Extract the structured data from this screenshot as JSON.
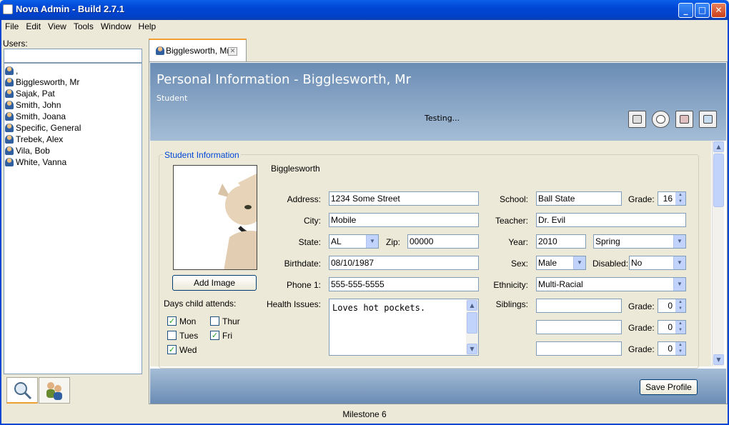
{
  "window": {
    "title": "Nova Admin - Build 2.7.1",
    "minimize": "_",
    "maximize": "□",
    "close": "✕"
  },
  "menu": [
    "File",
    "Edit",
    "View",
    "Tools",
    "Window",
    "Help"
  ],
  "users": {
    "label": "Users:",
    "search_value": "",
    "items": [
      ",",
      "Bigglesworth, Mr",
      "Sajak, Pat",
      "Smith, John",
      "Smith, Joana",
      "Specific, General",
      "Trebek, Alex",
      "Vila, Bob",
      "White, Vanna"
    ]
  },
  "tab": {
    "label": "Bigglesworth, Mr",
    "close": "✕"
  },
  "header": {
    "title": "Personal Information - Bigglesworth, Mr",
    "subtitle": "Student",
    "status": "Testing..."
  },
  "form": {
    "group_title": "Student Information",
    "name": "Bigglesworth",
    "add_image_label": "Add Image",
    "days_label": "Days child attends:",
    "days": [
      {
        "label": "Mon",
        "checked": true
      },
      {
        "label": "Tues",
        "checked": false
      },
      {
        "label": "Wed",
        "checked": true
      },
      {
        "label": "Thur",
        "checked": false
      },
      {
        "label": "Fri",
        "checked": true
      }
    ],
    "labels": {
      "address": "Address:",
      "city": "City:",
      "state": "State:",
      "zip": "Zip:",
      "birthdate": "Birthdate:",
      "phone": "Phone 1:",
      "health": "Health Issues:",
      "school": "School:",
      "grade": "Grade:",
      "teacher": "Teacher:",
      "year": "Year:",
      "sex": "Sex:",
      "disabled": "Disabled:",
      "ethnicity": "Ethnicity:",
      "siblings": "Siblings:"
    },
    "values": {
      "address": "1234 Some Street",
      "city": "Mobile",
      "state": "AL",
      "zip": "00000",
      "birthdate": "08/10/1987",
      "phone": "555-555-5555",
      "health": "Loves hot pockets.",
      "school": "Ball State",
      "grade": "16",
      "teacher": "Dr. Evil",
      "year": "2010",
      "term": "Spring",
      "sex": "Male",
      "disabled": "No",
      "ethnicity": "Multi-Racial",
      "sibling1": "",
      "sibling1_grade": "0",
      "sibling2": "",
      "sibling2_grade": "0",
      "sibling3": "",
      "sibling3_grade": "0"
    }
  },
  "footer": {
    "save_label": "Save Profile"
  },
  "statusbar": "Milestone 6"
}
